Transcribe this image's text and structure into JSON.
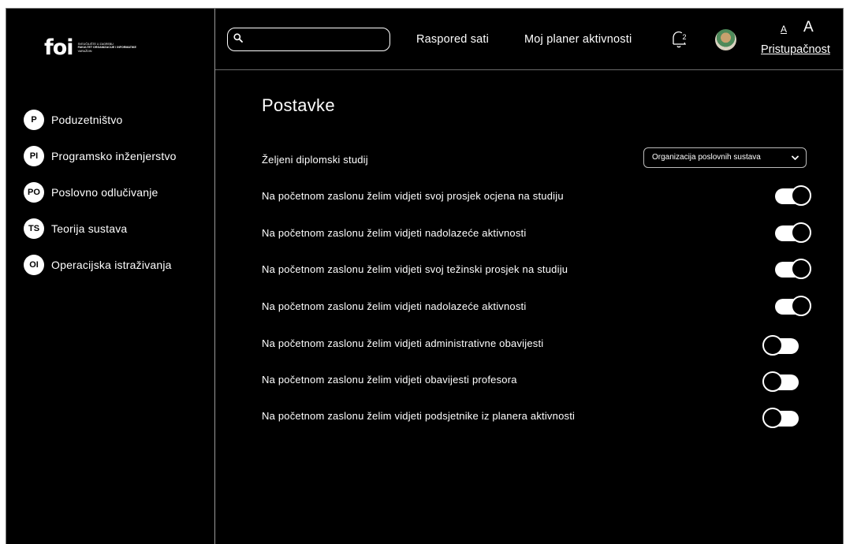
{
  "logo": {
    "brand": "foi",
    "line1": "SVEUČILIŠTE U ZAGREBU",
    "line2": "FAKULTET ORGANIZACIJE I INFORMATIKE",
    "line3": "VARAŽDIN"
  },
  "sidebar": {
    "items": [
      {
        "badge": "P",
        "label": "Poduzetništvo"
      },
      {
        "badge": "PI",
        "label": "Programsko inženjerstvo"
      },
      {
        "badge": "PO",
        "label": "Poslovno odlučivanje"
      },
      {
        "badge": "TS",
        "label": "Teorija sustava"
      },
      {
        "badge": "OI",
        "label": "Operacijska istraživanja"
      }
    ]
  },
  "header": {
    "search": {
      "value": "",
      "placeholder": ""
    },
    "link_schedule": "Raspored sati",
    "link_planner": "Moj planer aktivnosti",
    "notifications_count": "2",
    "font_small": "A",
    "font_large": "A",
    "accessibility": "Pristupačnost"
  },
  "main": {
    "title": "Postavke",
    "study": {
      "label": "Željeni diplomski studij",
      "selected": "Organizacija poslovnih sustava"
    },
    "settings": [
      {
        "label": "Na početnom zaslonu želim vidjeti svoj prosjek ocjena na studiju",
        "on": true
      },
      {
        "label": "Na početnom zaslonu želim vidjeti nadolazeće aktivnosti",
        "on": true
      },
      {
        "label": "Na početnom zaslonu želim vidjeti svoj težinski prosjek na studiju",
        "on": true
      },
      {
        "label": "Na početnom zaslonu želim vidjeti nadolazeće aktivnosti",
        "on": true
      },
      {
        "label": "Na početnom zaslonu želim vidjeti administrativne obavijesti",
        "on": false
      },
      {
        "label": "Na početnom zaslonu želim vidjeti obavijesti profesora",
        "on": false
      },
      {
        "label": "Na početnom zaslonu želim vidjeti podsjetnike iz planera aktivnosti",
        "on": false
      }
    ]
  },
  "colors": {
    "background": "#000000",
    "foreground": "#ffffff",
    "divider": "#9a9a9a"
  },
  "icons": {
    "search": "search-icon",
    "notifications": "bell-icon",
    "dropdown": "chevron-down-icon"
  }
}
